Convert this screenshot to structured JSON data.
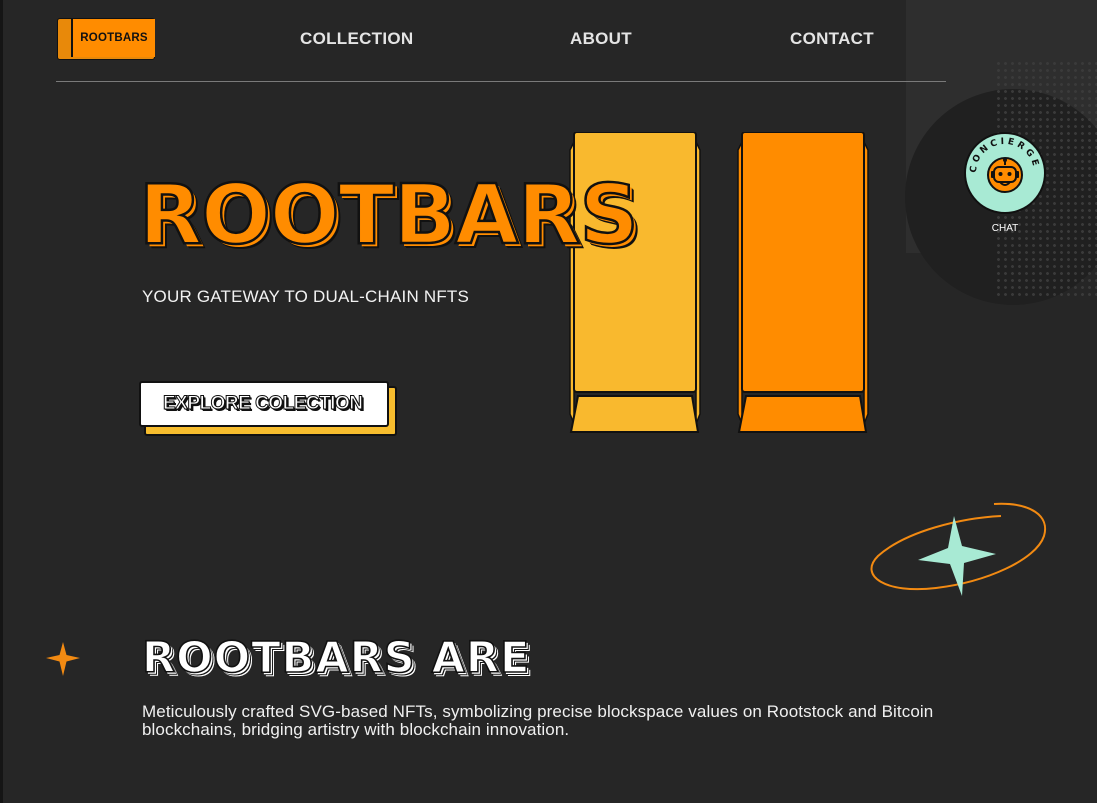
{
  "header": {
    "logo_text": "ROOTBARS",
    "nav": [
      {
        "label": "COLLECTION"
      },
      {
        "label": "ABOUT"
      },
      {
        "label": "CONTACT"
      }
    ]
  },
  "hero": {
    "title": "ROOTBARS",
    "tagline": "YOUR GATEWAY TO DUAL-CHAIN NFTS",
    "cta_label": "EXPLORE COLECTION"
  },
  "concierge": {
    "badge_text": "CONCIERGE",
    "label": "CHAT",
    "icon": "robot-icon"
  },
  "about": {
    "title": "ROOTBARS ARE",
    "description": "Meticulously crafted SVG-based NFTs, symbolizing precise blockspace values on Rootstock and Bitcoin blockchains, bridging artistry with blockchain innovation."
  },
  "colors": {
    "background": "#262626",
    "orange": "#ff8c00",
    "gold": "#f9b92e",
    "mint": "#a8ead4",
    "text": "#ffffff"
  }
}
